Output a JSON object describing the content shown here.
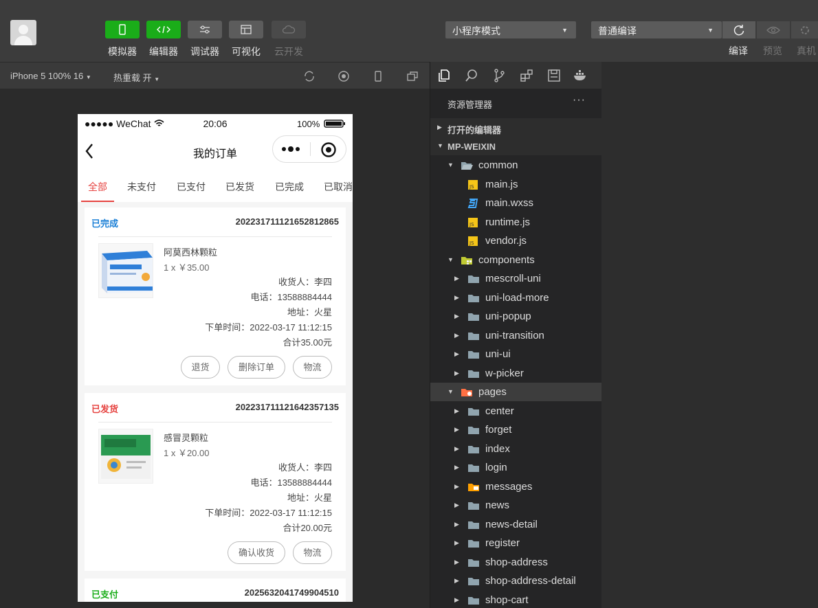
{
  "toolbar": {
    "tools": [
      {
        "label": "模拟器",
        "icon": "phone-icon"
      },
      {
        "label": "编辑器",
        "icon": "code-icon"
      },
      {
        "label": "调试器",
        "icon": "sliders-icon"
      },
      {
        "label": "可视化",
        "icon": "layout-icon"
      },
      {
        "label": "云开发",
        "icon": "cloud-icon"
      }
    ],
    "mode_select": "小程序模式",
    "compile_select": "普通编译",
    "compile_label": "编译",
    "preview_label": "预览",
    "real_device_label": "真机"
  },
  "simulator_bar": {
    "device": "iPhone 5 100% 16",
    "hot_reload": "热重载 开"
  },
  "phone": {
    "status": {
      "carrier": "●●●●● WeChat",
      "time": "20:06",
      "battery": "100%"
    },
    "nav_title": "我的订单",
    "tabs": [
      "全部",
      "未支付",
      "已支付",
      "已发货",
      "已完成",
      "已取消"
    ],
    "active_tab": "全部",
    "orders": [
      {
        "status": "已完成",
        "status_color": "#1a7fd6",
        "order_no": "202231711121652812865",
        "product": "阿莫西林颗粒",
        "qty_price": "1 x ￥35.00",
        "receiver": "收货人：李四",
        "phone": "电话：13588884444",
        "address": "地址：火星",
        "time": "下单时间：2022-03-17 11:12:15",
        "total": "合计35.00元",
        "buttons": [
          "退货",
          "删除订单",
          "物流"
        ]
      },
      {
        "status": "已发货",
        "status_color": "#e64340",
        "order_no": "202231711121642357135",
        "product": "感冒灵颗粒",
        "qty_price": "1 x ￥20.00",
        "receiver": "收货人：李四",
        "phone": "电话：13588884444",
        "address": "地址：火星",
        "time": "下单时间：2022-03-17 11:12:15",
        "total": "合计20.00元",
        "buttons": [
          "确认收货",
          "物流"
        ]
      },
      {
        "status": "已支付",
        "status_color": "#1aad19",
        "order_no": "2025632041749904510"
      }
    ]
  },
  "explorer": {
    "title": "资源管理器",
    "more": "···",
    "open_editors": "打开的编辑器",
    "project": "MP-WEIXIN",
    "tree": [
      {
        "name": "common",
        "type": "folder-open",
        "depth": 1,
        "expanded": true
      },
      {
        "name": "main.js",
        "type": "js",
        "depth": 2
      },
      {
        "name": "main.wxss",
        "type": "css",
        "depth": 2
      },
      {
        "name": "runtime.js",
        "type": "js",
        "depth": 2
      },
      {
        "name": "vendor.js",
        "type": "js",
        "depth": 2
      },
      {
        "name": "components",
        "type": "folder-special",
        "depth": 1,
        "expanded": true
      },
      {
        "name": "mescroll-uni",
        "type": "folder",
        "depth": 2
      },
      {
        "name": "uni-load-more",
        "type": "folder",
        "depth": 2
      },
      {
        "name": "uni-popup",
        "type": "folder",
        "depth": 2
      },
      {
        "name": "uni-transition",
        "type": "folder",
        "depth": 2
      },
      {
        "name": "uni-ui",
        "type": "folder",
        "depth": 2
      },
      {
        "name": "w-picker",
        "type": "folder",
        "depth": 2
      },
      {
        "name": "pages",
        "type": "folder-pages",
        "depth": 1,
        "expanded": true,
        "selected": true
      },
      {
        "name": "center",
        "type": "folder",
        "depth": 2
      },
      {
        "name": "forget",
        "type": "folder",
        "depth": 2
      },
      {
        "name": "index",
        "type": "folder",
        "depth": 2
      },
      {
        "name": "login",
        "type": "folder",
        "depth": 2
      },
      {
        "name": "messages",
        "type": "folder-messages",
        "depth": 2
      },
      {
        "name": "news",
        "type": "folder",
        "depth": 2
      },
      {
        "name": "news-detail",
        "type": "folder",
        "depth": 2
      },
      {
        "name": "register",
        "type": "folder",
        "depth": 2
      },
      {
        "name": "shop-address",
        "type": "folder",
        "depth": 2
      },
      {
        "name": "shop-address-detail",
        "type": "folder",
        "depth": 2
      },
      {
        "name": "shop-cart",
        "type": "folder",
        "depth": 2
      }
    ]
  }
}
